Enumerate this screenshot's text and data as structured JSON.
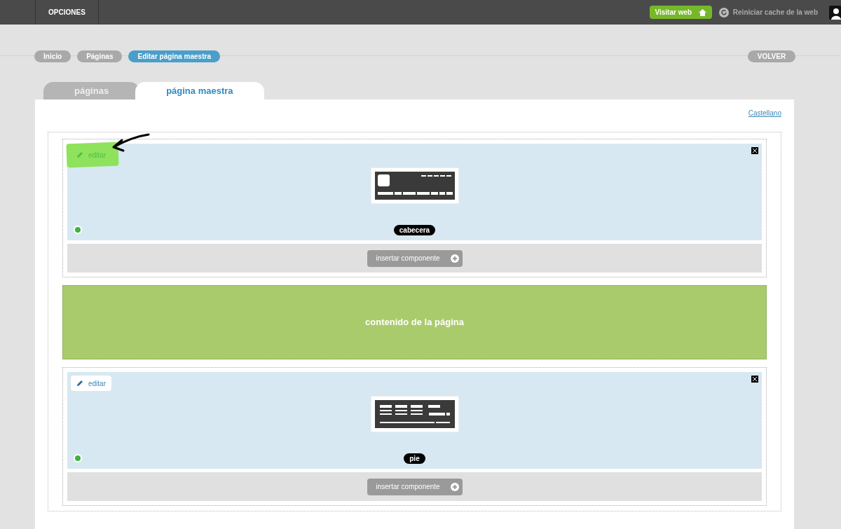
{
  "topbar": {
    "menu_label": "OPCIONES",
    "visit_button": "Visitar web",
    "reset_cache": "Reiniciar cache de la web"
  },
  "breadcrumbs": [
    {
      "label": "Inicio",
      "selected": false
    },
    {
      "label": "Páginas",
      "selected": false
    },
    {
      "label": "Editar página maestra",
      "selected": true
    }
  ],
  "back_button": "VOLVER",
  "tabs": [
    {
      "label": "páginas",
      "selected": false
    },
    {
      "label": "página maestra",
      "selected": true
    }
  ],
  "language_link": "Castellano",
  "sections": [
    {
      "kind": "header",
      "edit_label": "editar",
      "highlighted": true,
      "name": "cabecera",
      "active": true,
      "insert_label": "insertar componente"
    },
    {
      "kind": "content",
      "label": "contenido de la página"
    },
    {
      "kind": "footer",
      "edit_label": "editar",
      "highlighted": false,
      "name": "pie",
      "active": true,
      "insert_label": "insertar componente"
    }
  ]
}
